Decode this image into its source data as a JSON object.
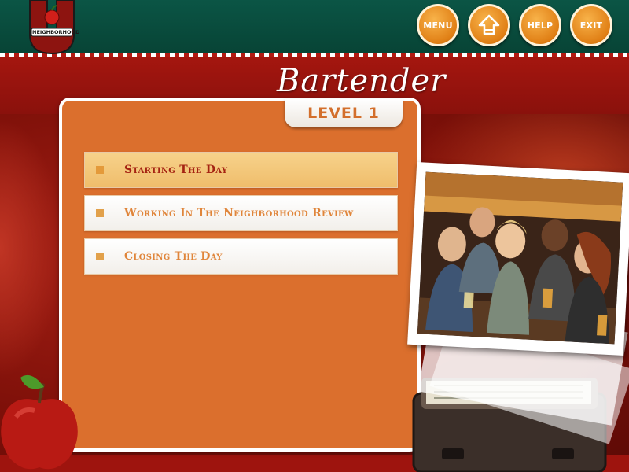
{
  "header": {
    "logo_text": "NEIGHBORHOOD",
    "nav": [
      {
        "id": "menu",
        "label": "MENU"
      },
      {
        "id": "home",
        "label": ""
      },
      {
        "id": "help",
        "label": "HELP"
      },
      {
        "id": "exit",
        "label": "EXIT"
      }
    ]
  },
  "title": {
    "script": "Bartender",
    "level": "LEVEL 1"
  },
  "menu": {
    "items": [
      {
        "label": "Starting The Day",
        "active": true
      },
      {
        "label": "Working In The Neighborhood Review",
        "active": false
      },
      {
        "label": "Closing The Day",
        "active": false
      }
    ]
  },
  "colors": {
    "header_green": "#074335",
    "panel_orange": "#db6f2d",
    "band_red": "#a4160f",
    "active_item": "#f7d28b",
    "active_text": "#a52312",
    "item_text": "#e0853a"
  }
}
